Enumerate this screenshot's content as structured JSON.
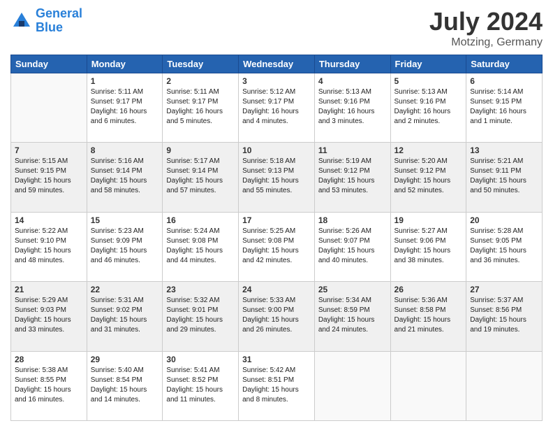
{
  "header": {
    "logo_line1": "General",
    "logo_line2": "Blue",
    "main_title": "July 2024",
    "sub_title": "Motzing, Germany"
  },
  "columns": [
    "Sunday",
    "Monday",
    "Tuesday",
    "Wednesday",
    "Thursday",
    "Friday",
    "Saturday"
  ],
  "weeks": [
    {
      "shaded": false,
      "days": [
        {
          "num": "",
          "info": ""
        },
        {
          "num": "1",
          "info": "Sunrise: 5:11 AM\nSunset: 9:17 PM\nDaylight: 16 hours\nand 6 minutes."
        },
        {
          "num": "2",
          "info": "Sunrise: 5:11 AM\nSunset: 9:17 PM\nDaylight: 16 hours\nand 5 minutes."
        },
        {
          "num": "3",
          "info": "Sunrise: 5:12 AM\nSunset: 9:17 PM\nDaylight: 16 hours\nand 4 minutes."
        },
        {
          "num": "4",
          "info": "Sunrise: 5:13 AM\nSunset: 9:16 PM\nDaylight: 16 hours\nand 3 minutes."
        },
        {
          "num": "5",
          "info": "Sunrise: 5:13 AM\nSunset: 9:16 PM\nDaylight: 16 hours\nand 2 minutes."
        },
        {
          "num": "6",
          "info": "Sunrise: 5:14 AM\nSunset: 9:15 PM\nDaylight: 16 hours\nand 1 minute."
        }
      ]
    },
    {
      "shaded": true,
      "days": [
        {
          "num": "7",
          "info": "Sunrise: 5:15 AM\nSunset: 9:15 PM\nDaylight: 15 hours\nand 59 minutes."
        },
        {
          "num": "8",
          "info": "Sunrise: 5:16 AM\nSunset: 9:14 PM\nDaylight: 15 hours\nand 58 minutes."
        },
        {
          "num": "9",
          "info": "Sunrise: 5:17 AM\nSunset: 9:14 PM\nDaylight: 15 hours\nand 57 minutes."
        },
        {
          "num": "10",
          "info": "Sunrise: 5:18 AM\nSunset: 9:13 PM\nDaylight: 15 hours\nand 55 minutes."
        },
        {
          "num": "11",
          "info": "Sunrise: 5:19 AM\nSunset: 9:12 PM\nDaylight: 15 hours\nand 53 minutes."
        },
        {
          "num": "12",
          "info": "Sunrise: 5:20 AM\nSunset: 9:12 PM\nDaylight: 15 hours\nand 52 minutes."
        },
        {
          "num": "13",
          "info": "Sunrise: 5:21 AM\nSunset: 9:11 PM\nDaylight: 15 hours\nand 50 minutes."
        }
      ]
    },
    {
      "shaded": false,
      "days": [
        {
          "num": "14",
          "info": "Sunrise: 5:22 AM\nSunset: 9:10 PM\nDaylight: 15 hours\nand 48 minutes."
        },
        {
          "num": "15",
          "info": "Sunrise: 5:23 AM\nSunset: 9:09 PM\nDaylight: 15 hours\nand 46 minutes."
        },
        {
          "num": "16",
          "info": "Sunrise: 5:24 AM\nSunset: 9:08 PM\nDaylight: 15 hours\nand 44 minutes."
        },
        {
          "num": "17",
          "info": "Sunrise: 5:25 AM\nSunset: 9:08 PM\nDaylight: 15 hours\nand 42 minutes."
        },
        {
          "num": "18",
          "info": "Sunrise: 5:26 AM\nSunset: 9:07 PM\nDaylight: 15 hours\nand 40 minutes."
        },
        {
          "num": "19",
          "info": "Sunrise: 5:27 AM\nSunset: 9:06 PM\nDaylight: 15 hours\nand 38 minutes."
        },
        {
          "num": "20",
          "info": "Sunrise: 5:28 AM\nSunset: 9:05 PM\nDaylight: 15 hours\nand 36 minutes."
        }
      ]
    },
    {
      "shaded": true,
      "days": [
        {
          "num": "21",
          "info": "Sunrise: 5:29 AM\nSunset: 9:03 PM\nDaylight: 15 hours\nand 33 minutes."
        },
        {
          "num": "22",
          "info": "Sunrise: 5:31 AM\nSunset: 9:02 PM\nDaylight: 15 hours\nand 31 minutes."
        },
        {
          "num": "23",
          "info": "Sunrise: 5:32 AM\nSunset: 9:01 PM\nDaylight: 15 hours\nand 29 minutes."
        },
        {
          "num": "24",
          "info": "Sunrise: 5:33 AM\nSunset: 9:00 PM\nDaylight: 15 hours\nand 26 minutes."
        },
        {
          "num": "25",
          "info": "Sunrise: 5:34 AM\nSunset: 8:59 PM\nDaylight: 15 hours\nand 24 minutes."
        },
        {
          "num": "26",
          "info": "Sunrise: 5:36 AM\nSunset: 8:58 PM\nDaylight: 15 hours\nand 21 minutes."
        },
        {
          "num": "27",
          "info": "Sunrise: 5:37 AM\nSunset: 8:56 PM\nDaylight: 15 hours\nand 19 minutes."
        }
      ]
    },
    {
      "shaded": false,
      "days": [
        {
          "num": "28",
          "info": "Sunrise: 5:38 AM\nSunset: 8:55 PM\nDaylight: 15 hours\nand 16 minutes."
        },
        {
          "num": "29",
          "info": "Sunrise: 5:40 AM\nSunset: 8:54 PM\nDaylight: 15 hours\nand 14 minutes."
        },
        {
          "num": "30",
          "info": "Sunrise: 5:41 AM\nSunset: 8:52 PM\nDaylight: 15 hours\nand 11 minutes."
        },
        {
          "num": "31",
          "info": "Sunrise: 5:42 AM\nSunset: 8:51 PM\nDaylight: 15 hours\nand 8 minutes."
        },
        {
          "num": "",
          "info": ""
        },
        {
          "num": "",
          "info": ""
        },
        {
          "num": "",
          "info": ""
        }
      ]
    }
  ]
}
